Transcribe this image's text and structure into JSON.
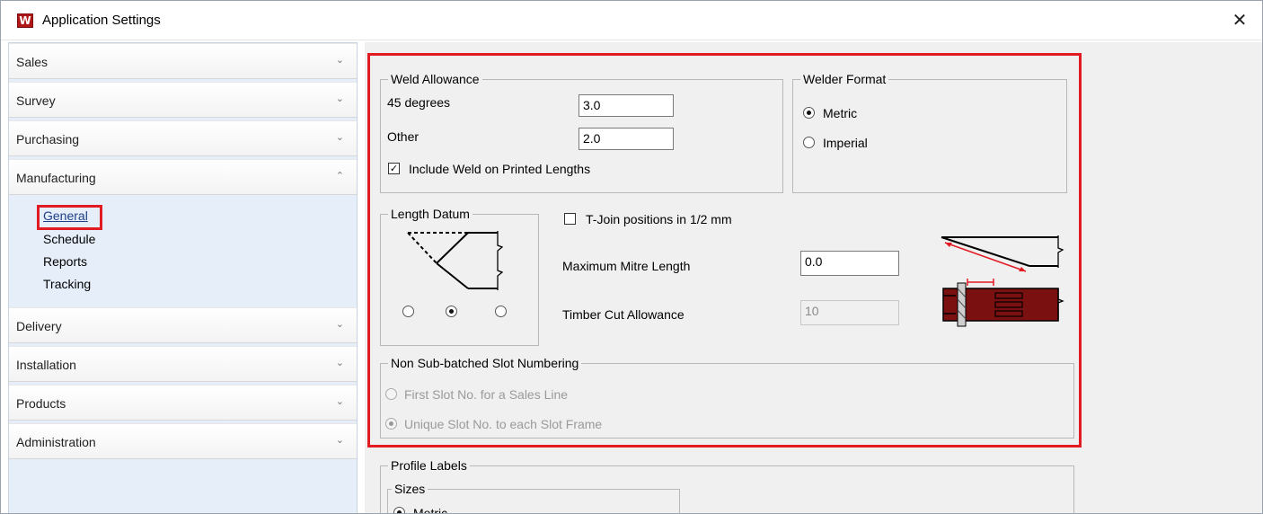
{
  "window": {
    "title": "Application Settings",
    "logo_glyph": "W",
    "close_glyph": "✕"
  },
  "sidebar": {
    "sections": [
      {
        "label": "Sales",
        "chevron": "⌄"
      },
      {
        "label": "Survey",
        "chevron": "⌄"
      },
      {
        "label": "Purchasing",
        "chevron": "⌄"
      },
      {
        "label": "Manufacturing",
        "chevron": "⌃"
      },
      {
        "label": "Delivery",
        "chevron": "⌄"
      },
      {
        "label": "Installation",
        "chevron": "⌄"
      },
      {
        "label": "Products",
        "chevron": "⌄"
      },
      {
        "label": "Administration",
        "chevron": "⌄"
      }
    ],
    "manufacturing_items": [
      {
        "label": "General",
        "active": true
      },
      {
        "label": "Schedule"
      },
      {
        "label": "Reports"
      },
      {
        "label": "Tracking"
      }
    ]
  },
  "weld_allowance": {
    "title": "Weld Allowance",
    "deg45_label": "45 degrees",
    "deg45_value": "3.0",
    "other_label": "Other",
    "other_value": "2.0",
    "include_weld_label": "Include Weld on Printed Lengths",
    "include_weld_checked": true
  },
  "welder_format": {
    "title": "Welder Format",
    "metric_label": "Metric",
    "imperial_label": "Imperial",
    "selected": "Metric"
  },
  "length_datum": {
    "title": "Length Datum",
    "selected_index": 1
  },
  "tjoin": {
    "label": "T-Join positions in 1/2 mm",
    "checked": false
  },
  "max_mitre": {
    "label": "Maximum Mitre Length",
    "value": "0.0"
  },
  "timber_cut": {
    "label": "Timber Cut Allowance",
    "value": "10"
  },
  "slot_numbering": {
    "title": "Non Sub-batched Slot Numbering",
    "option1": "First Slot No. for a Sales Line",
    "option2": "Unique Slot No. to each Slot Frame",
    "selected": "option2"
  },
  "profile_labels": {
    "title": "Profile  Labels",
    "sizes_title": "Sizes",
    "metric_label": "Metric"
  },
  "colors": {
    "accent_red": "#e21b23",
    "timber": "#7a1010"
  }
}
